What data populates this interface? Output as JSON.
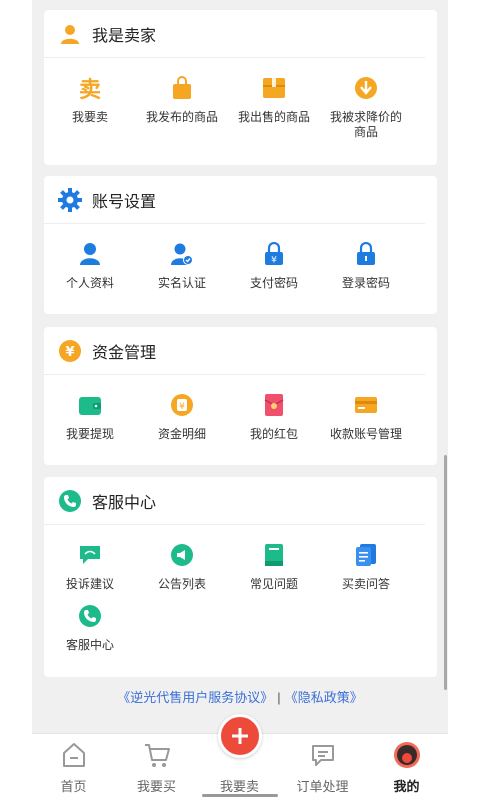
{
  "seller": {
    "title": "我是卖家",
    "items": [
      {
        "label": "我要卖",
        "icon": "sell-char-icon"
      },
      {
        "label": "我发布的商品",
        "icon": "shopping-bag-icon"
      },
      {
        "label": "我出售的商品",
        "icon": "package-box-icon"
      },
      {
        "label": "我被求降价的商品",
        "icon": "price-down-icon"
      }
    ],
    "sell_char": "卖"
  },
  "account": {
    "title": "账号设置",
    "items": [
      {
        "label": "个人资料",
        "icon": "user-icon"
      },
      {
        "label": "实名认证",
        "icon": "user-verified-icon"
      },
      {
        "label": "支付密码",
        "icon": "yen-lock-icon"
      },
      {
        "label": "登录密码",
        "icon": "lock-icon"
      }
    ]
  },
  "funds": {
    "title": "资金管理",
    "items": [
      {
        "label": "我要提现",
        "icon": "wallet-icon"
      },
      {
        "label": "资金明细",
        "icon": "yen-coin-icon"
      },
      {
        "label": "我的红包",
        "icon": "red-envelope-icon"
      },
      {
        "label": "收款账号管理",
        "icon": "card-icon"
      }
    ]
  },
  "service": {
    "title": "客服中心",
    "items": [
      {
        "label": "投诉建议",
        "icon": "feedback-icon"
      },
      {
        "label": "公告列表",
        "icon": "announcement-icon"
      },
      {
        "label": "常见问题",
        "icon": "faq-book-icon"
      },
      {
        "label": "买卖问答",
        "icon": "qa-doc-icon"
      },
      {
        "label": "客服中心",
        "icon": "phone-icon"
      }
    ]
  },
  "footer": {
    "agreement": "《逆光代售用户服务协议》",
    "separator": "|",
    "privacy": "《隐私政策》"
  },
  "tabbar": {
    "home": "首页",
    "buy": "我要买",
    "sell": "我要卖",
    "orders": "订单处理",
    "mine": "我的"
  },
  "colors": {
    "orange": "#f5a623",
    "blue": "#1e7ce0",
    "green": "#1dbb8a",
    "red": "#ee4a3a",
    "link": "#3b6fd6"
  }
}
